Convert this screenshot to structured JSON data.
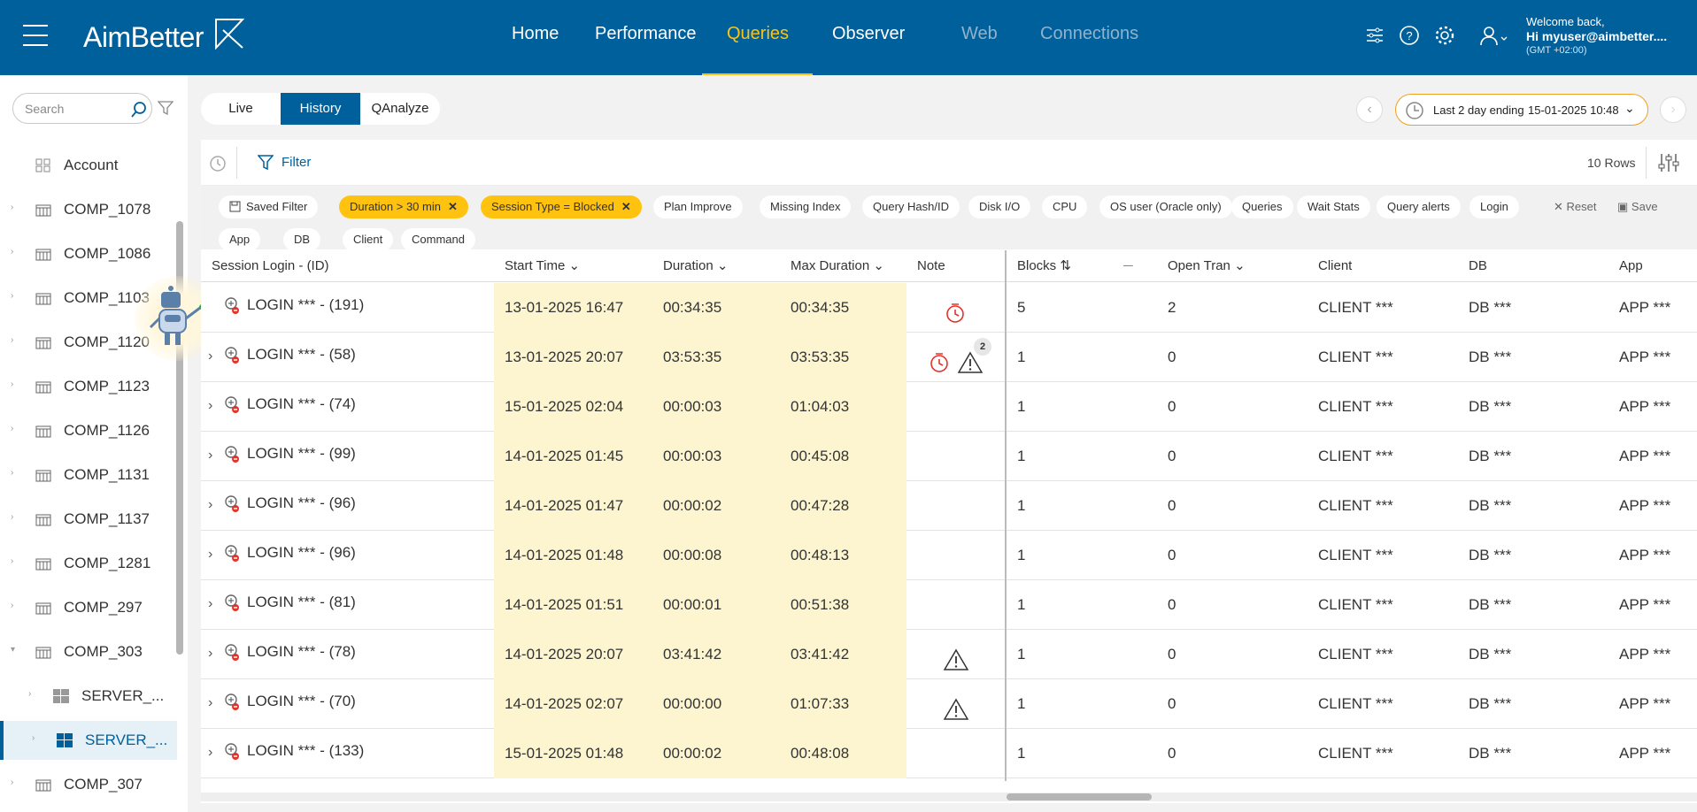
{
  "app": {
    "logo": "AimBetter"
  },
  "nav": {
    "home": "Home",
    "performance": "Performance",
    "queries": "Queries",
    "observer": "Observer",
    "web": "Web",
    "connections": "Connections"
  },
  "user": {
    "welcome": "Welcome back,",
    "name": "Hi myuser@aimbetter....",
    "tz": "(GMT +02:00)"
  },
  "sidebar": {
    "search_placeholder": "Search",
    "items": [
      {
        "label": "Account",
        "icon": "grid-icon"
      },
      {
        "label": "COMP_1078",
        "icon": "building-icon"
      },
      {
        "label": "COMP_1086",
        "icon": "building-icon"
      },
      {
        "label": "COMP_1103",
        "icon": "building-icon"
      },
      {
        "label": "COMP_1120",
        "icon": "building-icon"
      },
      {
        "label": "COMP_1123",
        "icon": "building-icon"
      },
      {
        "label": "COMP_1126",
        "icon": "building-icon"
      },
      {
        "label": "COMP_1131",
        "icon": "building-icon"
      },
      {
        "label": "COMP_1137",
        "icon": "building-icon"
      },
      {
        "label": "COMP_1281",
        "icon": "building-icon"
      },
      {
        "label": "COMP_297",
        "icon": "building-icon"
      },
      {
        "label": "COMP_303",
        "icon": "building-icon"
      },
      {
        "label": "SERVER_...",
        "icon": "windows-icon"
      },
      {
        "label": "SERVER_...",
        "icon": "windows-icon"
      },
      {
        "label": "COMP_307",
        "icon": "building-icon"
      }
    ]
  },
  "tabs": {
    "live": "Live",
    "history": "History",
    "qanalyze": "QAnalyze"
  },
  "date_range": {
    "label": "Last 2 day ending",
    "value": "15-01-2025 10:48"
  },
  "filter": {
    "label": "Filter",
    "rows": "10 Rows"
  },
  "chips": {
    "saved": "Saved Filter",
    "duration": "Duration > 30 min",
    "session": "Session Type = Blocked",
    "plan": "Plan Improve",
    "missing": "Missing Index",
    "hash": "Query Hash/ID",
    "disk": "Disk I/O",
    "cpu": "CPU",
    "osuser": "OS user (Oracle only)",
    "queries": "Queries",
    "wait": "Wait Stats",
    "alerts": "Query alerts",
    "login": "Login",
    "app": "App",
    "db": "DB",
    "client": "Client",
    "command": "Command",
    "reset": "Reset",
    "save": "Save"
  },
  "columns": {
    "session": "Session Login - (ID)",
    "start": "Start Time",
    "duration": "Duration",
    "maxdur": "Max Duration",
    "note": "Note",
    "blocks": "Blocks",
    "opentran": "Open Tran",
    "client": "Client",
    "db": "DB",
    "app": "App"
  },
  "rows": [
    {
      "login": "LOGIN *** - (191)",
      "start": "13-01-2025 16:47",
      "duration": "00:34:35",
      "max": "00:34:35",
      "blocks": "5",
      "open": "2",
      "client": "CLIENT ***",
      "db": "DB ***",
      "app": "APP ***"
    },
    {
      "login": "LOGIN *** - (58)",
      "start": "13-01-2025 20:07",
      "duration": "03:53:35",
      "max": "03:53:35",
      "blocks": "1",
      "open": "0",
      "client": "CLIENT ***",
      "db": "DB ***",
      "app": "APP ***",
      "badge": "2"
    },
    {
      "login": "LOGIN *** - (74)",
      "start": "15-01-2025 02:04",
      "duration": "00:00:03",
      "max": "01:04:03",
      "blocks": "1",
      "open": "0",
      "client": "CLIENT ***",
      "db": "DB ***",
      "app": "APP ***"
    },
    {
      "login": "LOGIN *** - (99)",
      "start": "14-01-2025 01:45",
      "duration": "00:00:03",
      "max": "00:45:08",
      "blocks": "1",
      "open": "0",
      "client": "CLIENT ***",
      "db": "DB ***",
      "app": "APP ***"
    },
    {
      "login": "LOGIN *** - (96)",
      "start": "14-01-2025 01:47",
      "duration": "00:00:02",
      "max": "00:47:28",
      "blocks": "1",
      "open": "0",
      "client": "CLIENT ***",
      "db": "DB ***",
      "app": "APP ***"
    },
    {
      "login": "LOGIN *** - (96)",
      "start": "14-01-2025 01:48",
      "duration": "00:00:08",
      "max": "00:48:13",
      "blocks": "1",
      "open": "0",
      "client": "CLIENT ***",
      "db": "DB ***",
      "app": "APP ***"
    },
    {
      "login": "LOGIN *** - (81)",
      "start": "14-01-2025 01:51",
      "duration": "00:00:01",
      "max": "00:51:38",
      "blocks": "1",
      "open": "0",
      "client": "CLIENT ***",
      "db": "DB ***",
      "app": "APP ***"
    },
    {
      "login": "LOGIN *** - (78)",
      "start": "14-01-2025 20:07",
      "duration": "03:41:42",
      "max": "03:41:42",
      "blocks": "1",
      "open": "0",
      "client": "CLIENT ***",
      "db": "DB ***",
      "app": "APP ***"
    },
    {
      "login": "LOGIN *** - (70)",
      "start": "14-01-2025 02:07",
      "duration": "00:00:00",
      "max": "01:07:33",
      "blocks": "1",
      "open": "0",
      "client": "CLIENT ***",
      "db": "DB ***",
      "app": "APP ***"
    },
    {
      "login": "LOGIN *** - (133)",
      "start": "15-01-2025 01:48",
      "duration": "00:00:02",
      "max": "00:48:08",
      "blocks": "1",
      "open": "0",
      "client": "CLIENT ***",
      "db": "DB ***",
      "app": "APP ***"
    }
  ],
  "colors": {
    "brand": "#00609b",
    "accent": "#ffc20e",
    "highlight": "#fcf5cf"
  }
}
